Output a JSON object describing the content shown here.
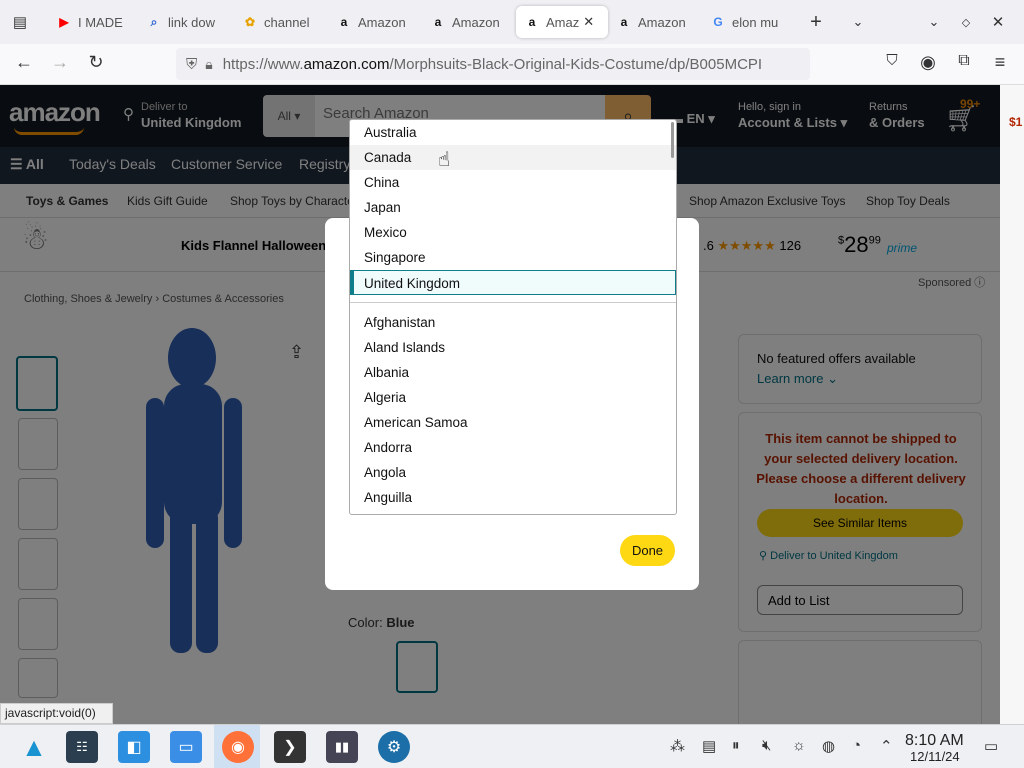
{
  "browser": {
    "tabs": [
      {
        "label": "I MADE",
        "icon": "youtube-icon"
      },
      {
        "label": "link dow",
        "icon": "search-icon"
      },
      {
        "label": "channel",
        "icon": "photos-icon"
      },
      {
        "label": "Amazon",
        "icon": "amazon-icon"
      },
      {
        "label": "Amazon",
        "icon": "amazon-icon"
      },
      {
        "label": "Amaz",
        "icon": "amazon-icon",
        "active": true
      },
      {
        "label": "Amazon",
        "icon": "amazon-icon"
      },
      {
        "label": "elon mu",
        "icon": "google-icon"
      }
    ],
    "url_prefix": "https://www.",
    "url_domain": "amazon.com",
    "url_path": "/Morphsuits-Black-Original-Kids-Costume/dp/B005MCPI"
  },
  "amazon": {
    "logo": "amazon",
    "deliver_to_label": "Deliver to",
    "deliver_to_value": "United Kingdom",
    "search_category": "All",
    "search_placeholder": "Search Amazon",
    "language": "EN",
    "account_line1": "Hello, sign in",
    "account_line2": "Account & Lists",
    "returns_line1": "Returns",
    "returns_line2": "& Orders",
    "cart_count": "99+",
    "nav": [
      "All",
      "Today's Deals",
      "Customer Service",
      "Registry"
    ],
    "subnav": [
      "Toys & Games",
      "Kids Gift Guide",
      "Shop Toys by Characte",
      "Shop Amazon Exclusive Toys",
      "Shop Toy Deals"
    ],
    "banner_title": "Kids Flannel Halloween",
    "banner_rating_fragment": ".6",
    "banner_reviews": "126",
    "banner_price_whole": "28",
    "banner_price_cents": "99",
    "banner_prime": "prime",
    "sponsored": "Sponsored",
    "breadcrumb": [
      "Clothing, Shoes & Jewelry",
      "Costumes & Accessories"
    ],
    "color_label": "Color:",
    "color_value": "Blue",
    "offers_text": "No featured offers available",
    "learn_more": "Learn more",
    "ship_warning": "This item cannot be shipped to your selected delivery location. Please choose a different delivery location.",
    "see_similar": "See Similar Items",
    "deliver_link": "Deliver to United Kingdom",
    "add_to_list": "Add to List",
    "truncated_price": "$1"
  },
  "modal": {
    "done_label": "Done",
    "countries_top": [
      "Australia",
      "Canada",
      "China",
      "Japan",
      "Mexico",
      "Singapore",
      "United Kingdom"
    ],
    "countries_all": [
      "Afghanistan",
      "Aland Islands",
      "Albania",
      "Algeria",
      "American Samoa",
      "Andorra",
      "Angola",
      "Anguilla"
    ],
    "selected": "United Kingdom",
    "hovered": "Canada"
  },
  "status_bar": "javascript:void(0)",
  "taskbar": {
    "time": "8:10 AM",
    "date": "12/11/24"
  },
  "colors": {
    "amazon_dark": "#131921",
    "amazon_nav": "#232f3e",
    "accent_yellow": "#ffd814",
    "warning_red": "#b12704",
    "link_teal": "#007185"
  }
}
